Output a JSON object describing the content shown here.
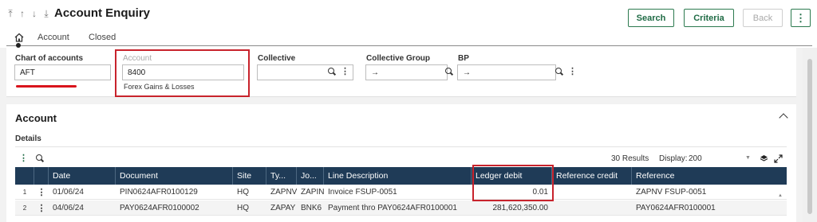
{
  "header": {
    "title": "Account Enquiry",
    "nav_icons": [
      "first-record-icon",
      "up-arrow-icon",
      "down-arrow-icon",
      "last-record-icon"
    ],
    "buttons": {
      "search": "Search",
      "criteria": "Criteria",
      "back": "Back",
      "more": "⋮"
    }
  },
  "tabs": {
    "home_icon": "home-icon",
    "items": [
      "Account",
      "Closed"
    ]
  },
  "criteria": {
    "chart_of_accounts": {
      "label": "Chart of accounts",
      "value": "AFT"
    },
    "account": {
      "label": "Account",
      "value": "8400",
      "description": "Forex Gains & Losses"
    },
    "collective": {
      "label": "Collective",
      "value": ""
    },
    "collective_group": {
      "label": "Collective Group",
      "value": "→"
    },
    "bp": {
      "label": "BP",
      "value": "→"
    }
  },
  "section": {
    "title": "Account",
    "subtitle": "Details",
    "results": "30 Results",
    "display_label": "Display:",
    "display_value": "200"
  },
  "table": {
    "columns": [
      "Date",
      "Document",
      "Site",
      "Ty...",
      "Jo...",
      "Line Description",
      "Ledger debit",
      "Reference credit",
      "Reference"
    ],
    "rows": [
      {
        "no": "1",
        "date": "01/06/24",
        "document": "PIN0624AFR0100129",
        "site": "HQ",
        "type": "ZAPNV",
        "journal": "ZAPIN",
        "line_description": "Invoice FSUP-0051",
        "ledger_debit": "0.01",
        "reference_credit": "",
        "reference": "ZAPNV FSUP-0051"
      },
      {
        "no": "2",
        "date": "04/06/24",
        "document": "PAY0624AFR0100002",
        "site": "HQ",
        "type": "ZAPAY",
        "journal": "BNK6",
        "line_description": "Payment thro PAY0624AFR0100001",
        "ledger_debit": "281,620,350.00",
        "reference_credit": "",
        "reference": "PAY0624AFR0100001"
      }
    ]
  },
  "colors": {
    "table_header": "#1f3b57",
    "accent_green": "#1f6b45",
    "highlight_red": "#c8232c"
  }
}
